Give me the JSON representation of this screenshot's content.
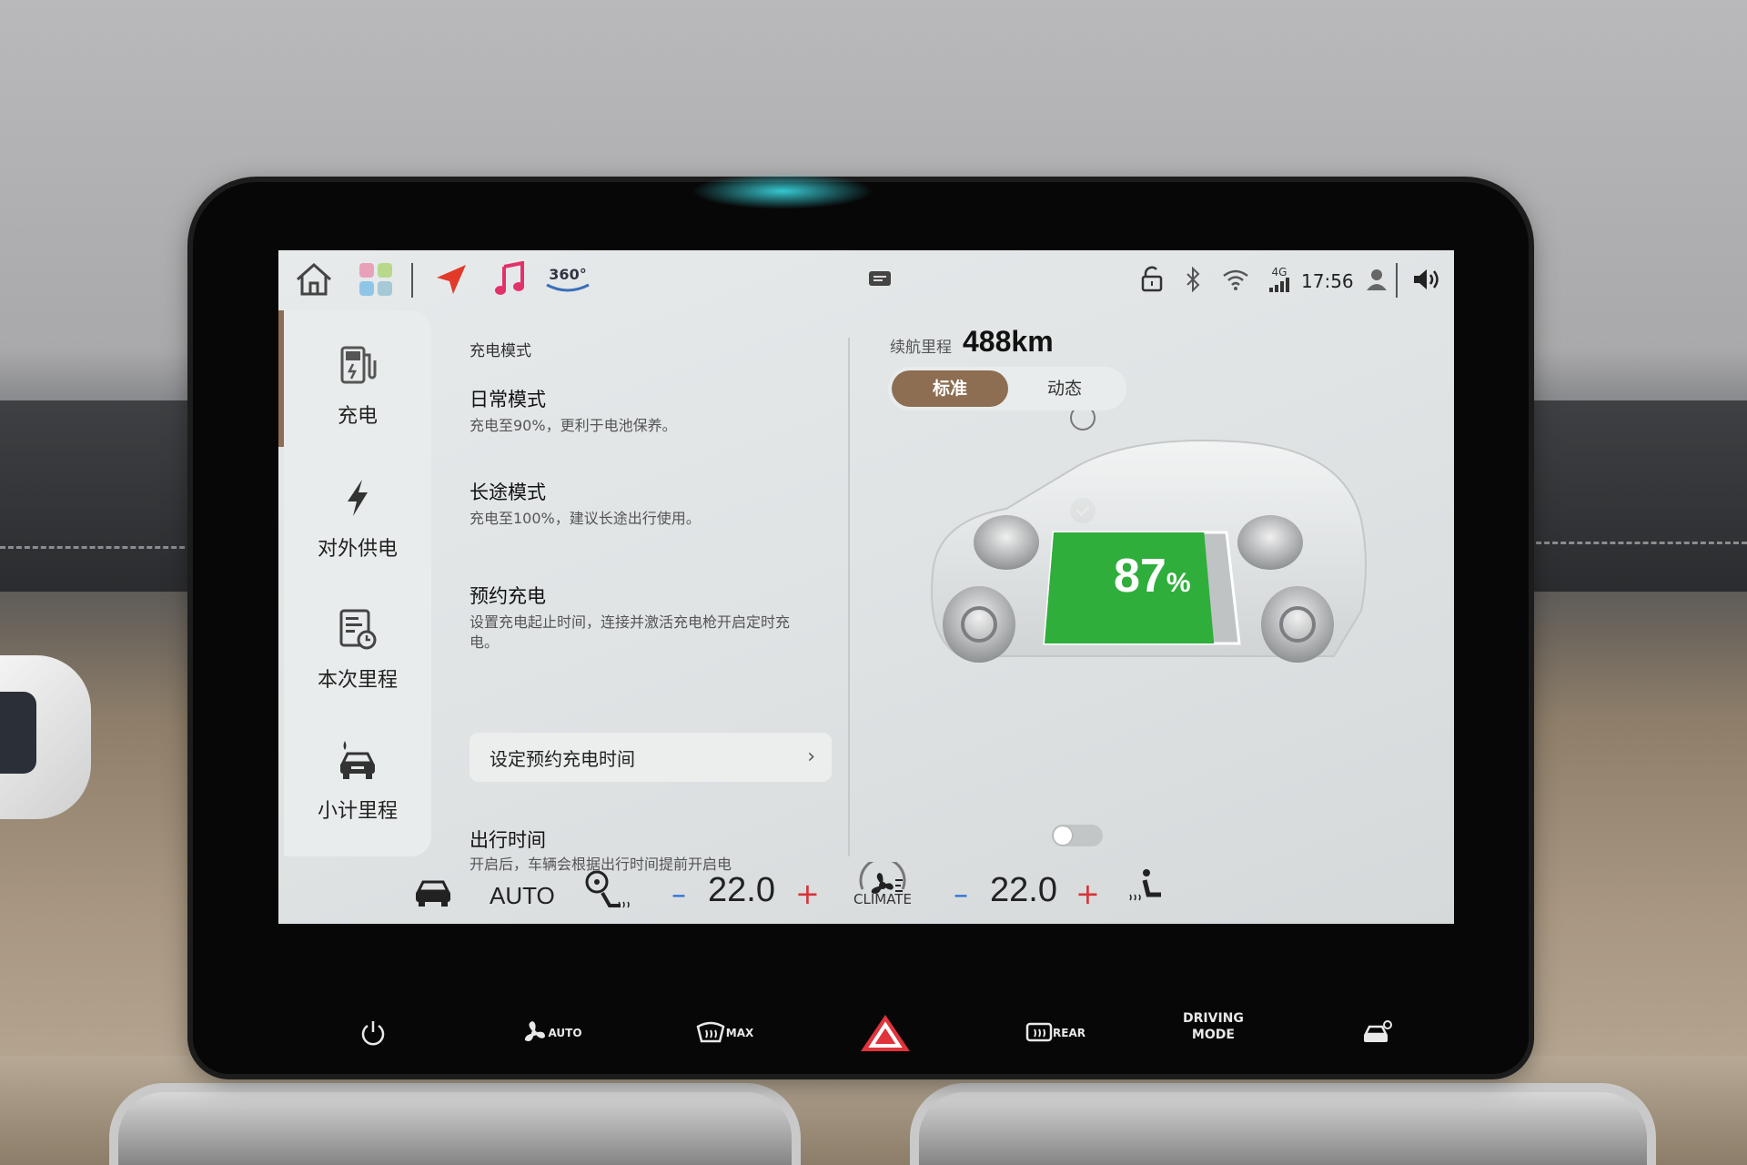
{
  "statusbar": {
    "icons": [
      "home-icon",
      "apps-icon",
      "navigation-icon",
      "music-icon",
      "360-camera-icon",
      "message-icon",
      "lock-icon",
      "bluetooth-icon",
      "wifi-icon",
      "signal-icon",
      "user-icon",
      "volume-icon"
    ],
    "camera_label": "360°",
    "network_label": "4G",
    "time": "17:56"
  },
  "sidebar": {
    "items": [
      {
        "label": "充电",
        "icon": "charging-station-icon",
        "active": true
      },
      {
        "label": "对外供电",
        "icon": "lightning-icon",
        "active": false
      },
      {
        "label": "本次里程",
        "icon": "trip-report-icon",
        "active": false
      },
      {
        "label": "小计里程",
        "icon": "car-fuel-icon",
        "active": false
      }
    ]
  },
  "charge": {
    "section_title": "充电模式",
    "daily": {
      "title": "日常模式",
      "desc": "充电至90%，更利于电池保养。",
      "selected": false
    },
    "long_trip": {
      "title": "长途模式",
      "desc": "充电至100%，建议长途出行使用。",
      "selected": true
    },
    "scheduled": {
      "title": "预约充电",
      "desc": "设置充电起止时间，连接并激活充电枪开启定时充电。"
    },
    "schedule_button": "设定预约充电时间",
    "departure": {
      "title": "出行时间",
      "desc": "开启后，车辆会根据出行时间提前开启电",
      "enabled": false
    }
  },
  "vehicle": {
    "range_label": "续航里程",
    "range_value": "488km",
    "mode_options": [
      "标准",
      "动态"
    ],
    "mode_selected": "标准",
    "battery_percent": 87,
    "battery_number": "87",
    "battery_unit": "%",
    "battery_color": "#2fae3c"
  },
  "climate": {
    "auto_label": "AUTO",
    "left_temp": "22.0",
    "right_temp": "22.0",
    "climate_label": "CLIMATE",
    "minus": "–",
    "plus": "+"
  },
  "hardware": {
    "fan_auto": "AUTO",
    "defrost_max": "MAX",
    "rear_defrost": "REAR",
    "driving_mode_1": "DRIVING",
    "driving_mode_2": "MODE"
  },
  "colors": {
    "accent": "#8d6e52",
    "temp_minus": "#2d6fd6",
    "temp_plus": "#d4343a",
    "hazard": "#e0333b"
  }
}
